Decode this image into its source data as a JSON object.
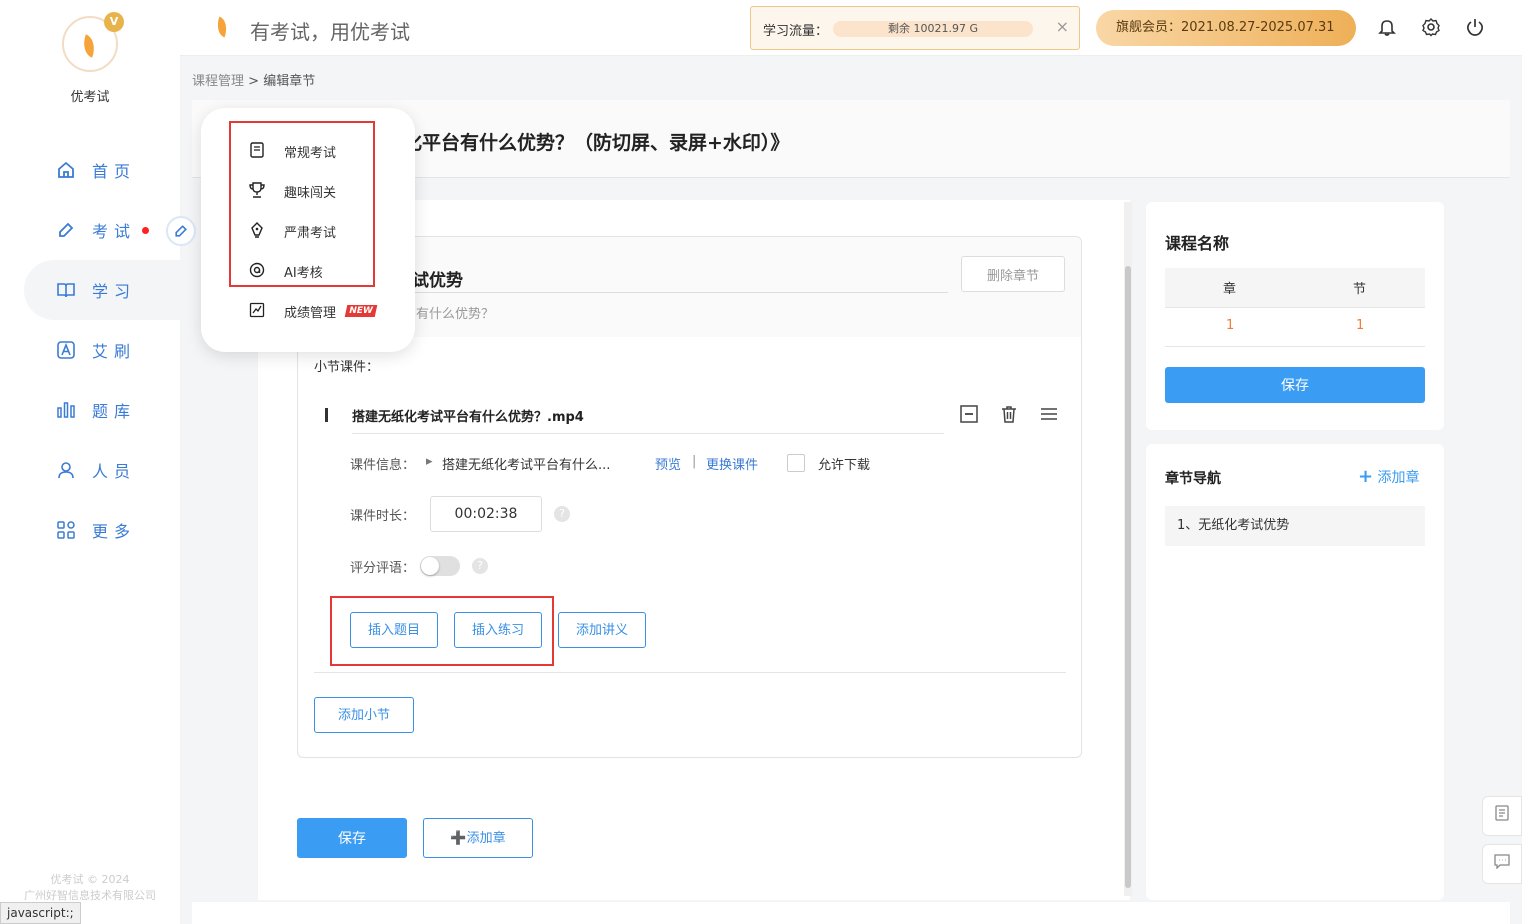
{
  "sidebar": {
    "brand": "优考试",
    "crown_badge": "V",
    "items": [
      {
        "label": "首页",
        "icon": "home-icon"
      },
      {
        "label": "考试",
        "icon": "exam-icon"
      },
      {
        "label": "学习",
        "icon": "book-icon"
      },
      {
        "label": "艾刷",
        "icon": "letter-a-icon"
      },
      {
        "label": "题库",
        "icon": "bar-chart-icon"
      },
      {
        "label": "人员",
        "icon": "user-icon"
      },
      {
        "label": "更多",
        "icon": "grid-icon"
      }
    ],
    "copyright_line1": "优考试 © 2024",
    "copyright_line2": "广州好智信息技术有限公司",
    "status_url": "javascript:;"
  },
  "header": {
    "slogan": "有考试，用优考试",
    "traffic_label": "学习流量：",
    "traffic_remaining": "剩余 10021.97 G",
    "close_glyph": "×",
    "member_text": "旗舰会员：2021.08.27-2025.07.31",
    "icons": [
      "bell-icon",
      "gear-icon",
      "power-icon"
    ]
  },
  "breadcrumb": {
    "parent": "课程管理",
    "separator": ">",
    "current": "编辑章节"
  },
  "page": {
    "title": "纸化平台有什么优势？（防切屏、录屏+水印）》"
  },
  "popup_menu": {
    "items": [
      {
        "label": "常规考试",
        "icon": "document-icon"
      },
      {
        "label": "趣味闯关",
        "icon": "trophy-icon"
      },
      {
        "label": "严肃考试",
        "icon": "pen-icon"
      },
      {
        "label": "AI考核",
        "icon": "ai-icon"
      },
      {
        "label": "成绩管理",
        "icon": "chart-icon",
        "badge": "NEW"
      }
    ]
  },
  "chapter": {
    "name": "试优势",
    "description": "有什么优势？",
    "delete_label": "删除章节",
    "section_label": "小节课件：",
    "item": {
      "name": "搭建无纸化考试平台有什么优势？.mp4",
      "info_label": "课件信息：",
      "info_value": "搭建无纸化考试平台有什么...",
      "preview": "预览",
      "separator": "|",
      "replace": "更换课件",
      "allow_download": "允许下载",
      "duration_label": "课件时长：",
      "duration_value": "00:02:38",
      "comment_label": "评分评语：",
      "help_glyph": "?"
    },
    "buttons": {
      "insert_question": "插入题目",
      "insert_practice": "插入练习",
      "add_handout": "添加讲义",
      "add_section": "添加小节"
    }
  },
  "footer_buttons": {
    "save": "保存",
    "add_chapter": "➕添加章"
  },
  "right_panel": {
    "course_title": "课程名称",
    "table": {
      "headers": [
        "章",
        "节"
      ],
      "values": [
        "1",
        "1"
      ]
    },
    "save": "保存",
    "nav_title": "章节导航",
    "add_chapter": "添加章",
    "nav_items": [
      "1、无纸化考试优势"
    ]
  },
  "colors": {
    "primary": "#3a9cf2",
    "nav_blue": "#3a7bd5",
    "highlight_red": "#e53935",
    "count_orange": "#f07c3c"
  }
}
